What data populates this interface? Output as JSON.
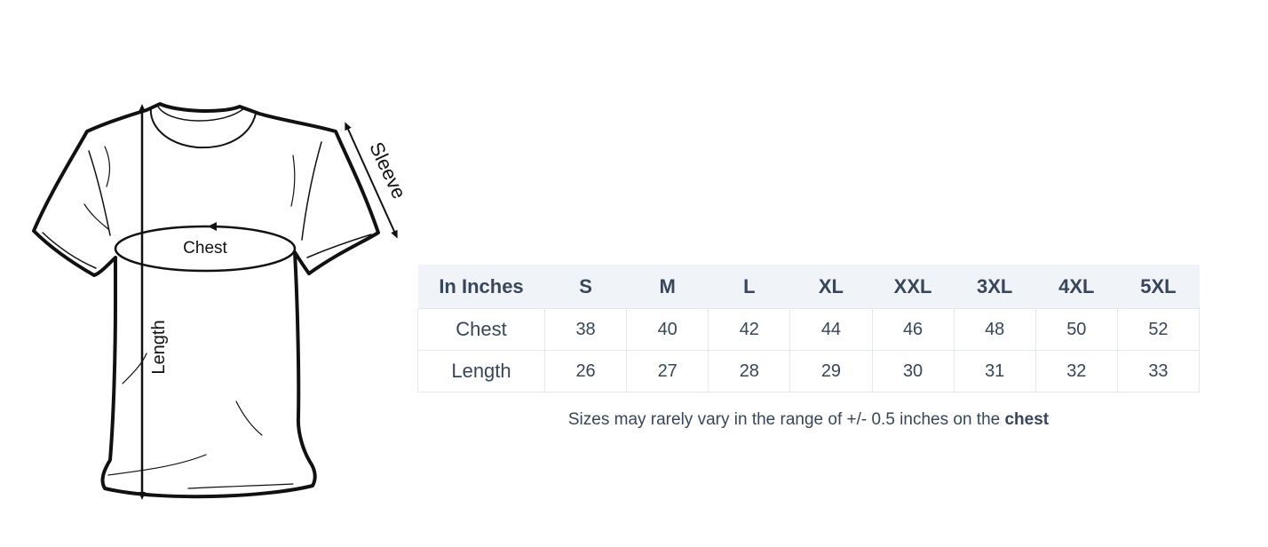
{
  "diagram": {
    "labels": {
      "chest": "Chest",
      "sleeve": "Sleeve",
      "length": "Length"
    }
  },
  "size_table": {
    "header_label": "In Inches",
    "sizes": [
      "S",
      "M",
      "L",
      "XL",
      "XXL",
      "3XL",
      "4XL",
      "5XL"
    ],
    "rows": [
      {
        "label": "Chest",
        "values": [
          "38",
          "40",
          "42",
          "44",
          "46",
          "48",
          "50",
          "52"
        ]
      },
      {
        "label": "Length",
        "values": [
          "26",
          "27",
          "28",
          "29",
          "30",
          "31",
          "32",
          "33"
        ]
      }
    ]
  },
  "note": {
    "text": "Sizes may rarely vary in the range of +/- 0.5 inches on the ",
    "emphasis": "chest"
  },
  "colors": {
    "text": "#37465a",
    "header_bg": "#f0f4f8",
    "border": "#e4e7eb"
  }
}
